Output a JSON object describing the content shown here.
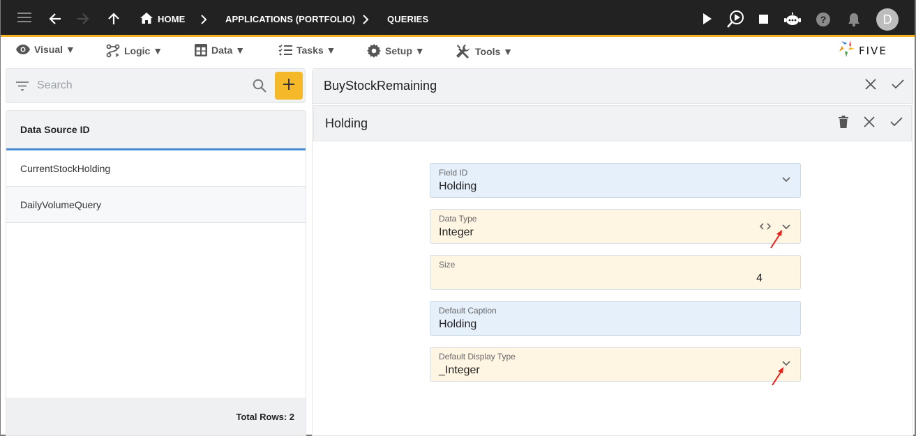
{
  "topbar": {
    "breadcrumbs": [
      {
        "label": "HOME",
        "icon": "home-icon"
      },
      {
        "label": "APPLICATIONS (PORTFOLIO)"
      },
      {
        "label": "QUERIES"
      }
    ],
    "icons": [
      "menu-icon",
      "back-icon",
      "forward-icon",
      "up-icon",
      "run-icon",
      "debug-run-icon",
      "stop-icon",
      "chat-bot-icon",
      "help-icon",
      "notifications-icon"
    ],
    "avatar_initial": "D"
  },
  "menubar": {
    "items": [
      {
        "label": "Visual ▼",
        "icon": "eye-icon"
      },
      {
        "label": "Logic ▼",
        "icon": "logic-icon"
      },
      {
        "label": "Data ▼",
        "icon": "table-icon"
      },
      {
        "label": "Tasks ▼",
        "icon": "tasks-icon"
      },
      {
        "label": "Setup ▼",
        "icon": "gear-icon"
      },
      {
        "label": "Tools ▼",
        "icon": "tools-icon"
      }
    ],
    "logo_text": "FIVE"
  },
  "left_panel": {
    "search_placeholder": "Search",
    "add_label": "+",
    "column_header": "Data Source ID",
    "rows": [
      "CurrentStockHolding",
      "DailyVolumeQuery"
    ],
    "total_rows_label": "Total Rows: 2"
  },
  "right_panel": {
    "parent_title": "BuyStockRemaining",
    "child_title": "Holding",
    "fields": [
      {
        "label": "Field ID",
        "value": "Holding",
        "type": "dropdown"
      },
      {
        "label": "Data Type",
        "value": "Integer",
        "type": "dropdown-code"
      },
      {
        "label": "Size",
        "value": "4",
        "type": "number"
      },
      {
        "label": "Default Caption",
        "value": "Holding",
        "type": "text"
      },
      {
        "label": "Default Display Type",
        "value": "_Integer",
        "type": "dropdown"
      }
    ]
  },
  "colors": {
    "topbar_bg": "#222222",
    "accent": "#f5b324",
    "selected_underline": "#4a8ad4",
    "field_blue": "#e6f0fb",
    "field_tan": "#fef5e3",
    "annotation_arrow": "#e8201a"
  }
}
